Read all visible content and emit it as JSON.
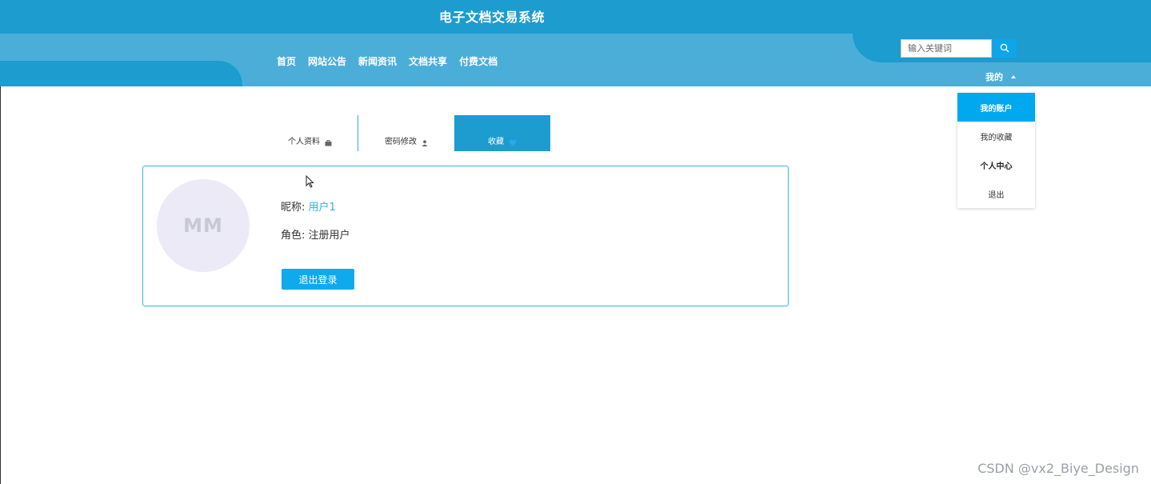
{
  "header": {
    "title": "电子文档交易系统",
    "nav": [
      "首页",
      "网站公告",
      "新闻资讯",
      "文档共享",
      "付费文档"
    ],
    "search_placeholder": "输入关键词",
    "my_label": "我的"
  },
  "dropdown": {
    "items": [
      "我的账户",
      "我的收藏",
      "个人中心",
      "退出"
    ]
  },
  "tabs": [
    {
      "label": "个人资料",
      "icon": "briefcase-icon"
    },
    {
      "label": "密码修改",
      "icon": "user-icon"
    },
    {
      "label": "收藏",
      "icon": "heart-icon"
    }
  ],
  "profile": {
    "avatar_initials": "MM",
    "nickname_label": "昵称:",
    "nickname_value": "用户1",
    "role_label": "角色:",
    "role_value": "注册用户",
    "logout_label": "退出登录"
  },
  "watermark": "CSDN @vx2_Biye_Design",
  "colors": {
    "header_dark": "#1c9ccf",
    "header_light": "#4aaed8",
    "accent": "#00a8ef",
    "card_border": "#35b7d8"
  }
}
